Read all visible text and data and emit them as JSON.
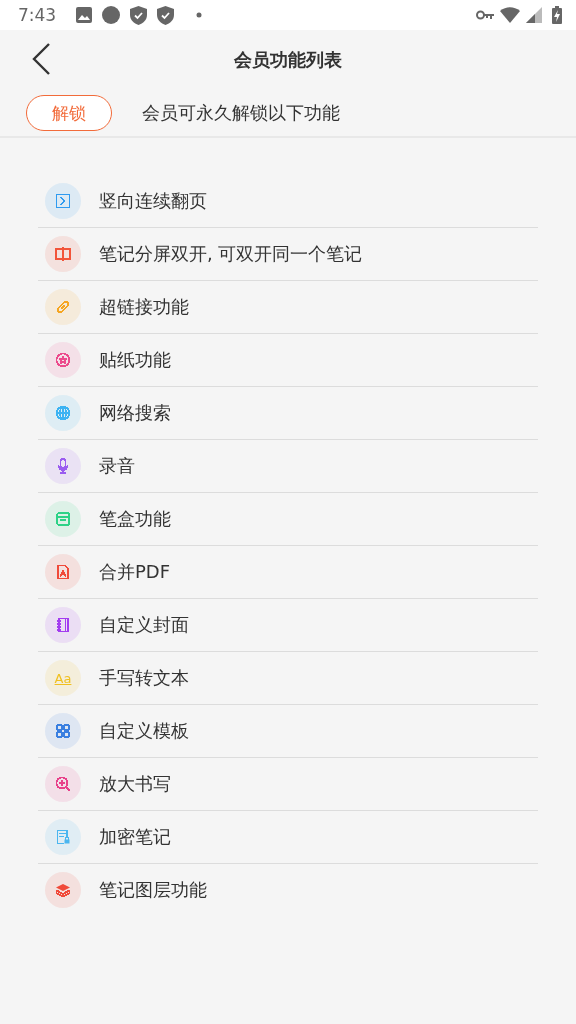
{
  "status_bar": {
    "time": "7:43"
  },
  "header": {
    "title": "会员功能列表"
  },
  "unlock": {
    "button": "解锁",
    "text": "会员可永久解锁以下功能"
  },
  "features": [
    {
      "label": "竖向连续翻页",
      "kind": "page-arrow",
      "color": "#2f9bf0"
    },
    {
      "label": "笔记分屏双开, 可双开同一个笔记",
      "kind": "split",
      "color": "#f2543a"
    },
    {
      "label": "超链接功能",
      "kind": "link",
      "color": "#f5a623"
    },
    {
      "label": "贴纸功能",
      "kind": "sticker",
      "color": "#ec4a8c"
    },
    {
      "label": "网络搜索",
      "kind": "globe",
      "color": "#3db3f2"
    },
    {
      "label": "录音",
      "kind": "mic",
      "color": "#9a5cf0"
    },
    {
      "label": "笔盒功能",
      "kind": "box",
      "color": "#2ed287"
    },
    {
      "label": "合并PDF",
      "kind": "pdf",
      "color": "#f04a3a"
    },
    {
      "label": "自定义封面",
      "kind": "notebook",
      "color": "#a33cf0"
    },
    {
      "label": "手写转文本",
      "kind": "glyph",
      "glyph": "Aa",
      "color": "#f0c020"
    },
    {
      "label": "自定义模板",
      "kind": "grid",
      "color": "#3a7fe0"
    },
    {
      "label": "放大书写",
      "kind": "zoom",
      "color": "#e8408a"
    },
    {
      "label": "加密笔记",
      "kind": "doc-lock",
      "color": "#4ab6f0"
    },
    {
      "label": "笔记图层功能",
      "kind": "layers",
      "color": "#f04a3a"
    }
  ]
}
